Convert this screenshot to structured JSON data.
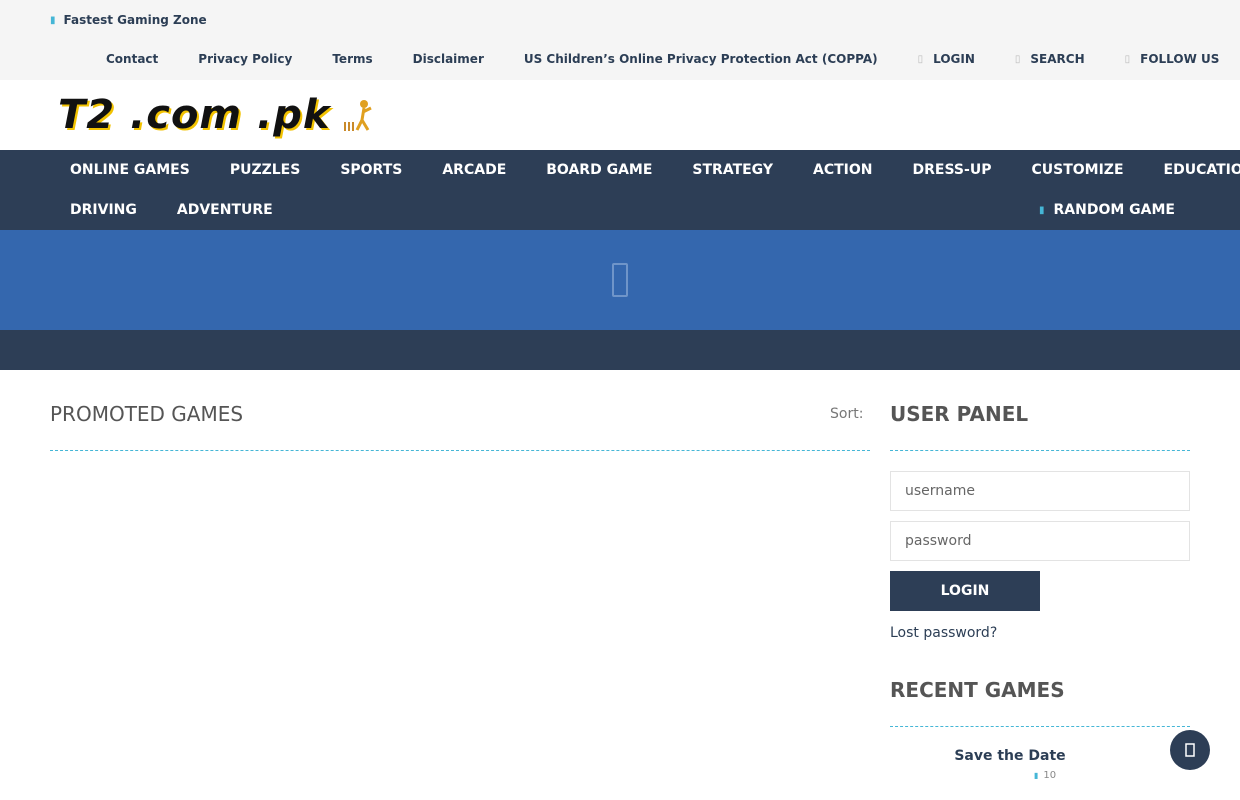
{
  "topbar": {
    "tagline": "Fastest Gaming Zone",
    "links": [
      "Contact",
      "Privacy Policy",
      "Terms",
      "Disclaimer",
      "US Children’s Online Privacy Protection Act (COPPA)"
    ],
    "login": "LOGIN",
    "search": "SEARCH",
    "follow": "FOLLOW US"
  },
  "logo": {
    "text": "T2 .com .pk"
  },
  "nav": {
    "row1": [
      "ONLINE GAMES",
      "PUZZLES",
      "SPORTS",
      "ARCADE",
      "BOARD GAME",
      "STRATEGY",
      "ACTION",
      "DRESS-UP",
      "CUSTOMIZE",
      "EDUCATION"
    ],
    "row2": [
      "DRIVING",
      "ADVENTURE"
    ],
    "random": "RANDOM GAME"
  },
  "promoted": {
    "title": "PROMOTED GAMES",
    "sort_label": "Sort:"
  },
  "user_panel": {
    "title": "USER PANEL",
    "username_placeholder": "username",
    "password_placeholder": "password",
    "login_label": "LOGIN",
    "lost_password": "Lost password?"
  },
  "recent": {
    "title": "RECENT GAMES",
    "item_title": "Save the Date",
    "item_plays": "10"
  },
  "colors": {
    "nav_bg": "#2d3e56",
    "banner_bg": "#3467ae",
    "accent": "#45b6d6"
  }
}
